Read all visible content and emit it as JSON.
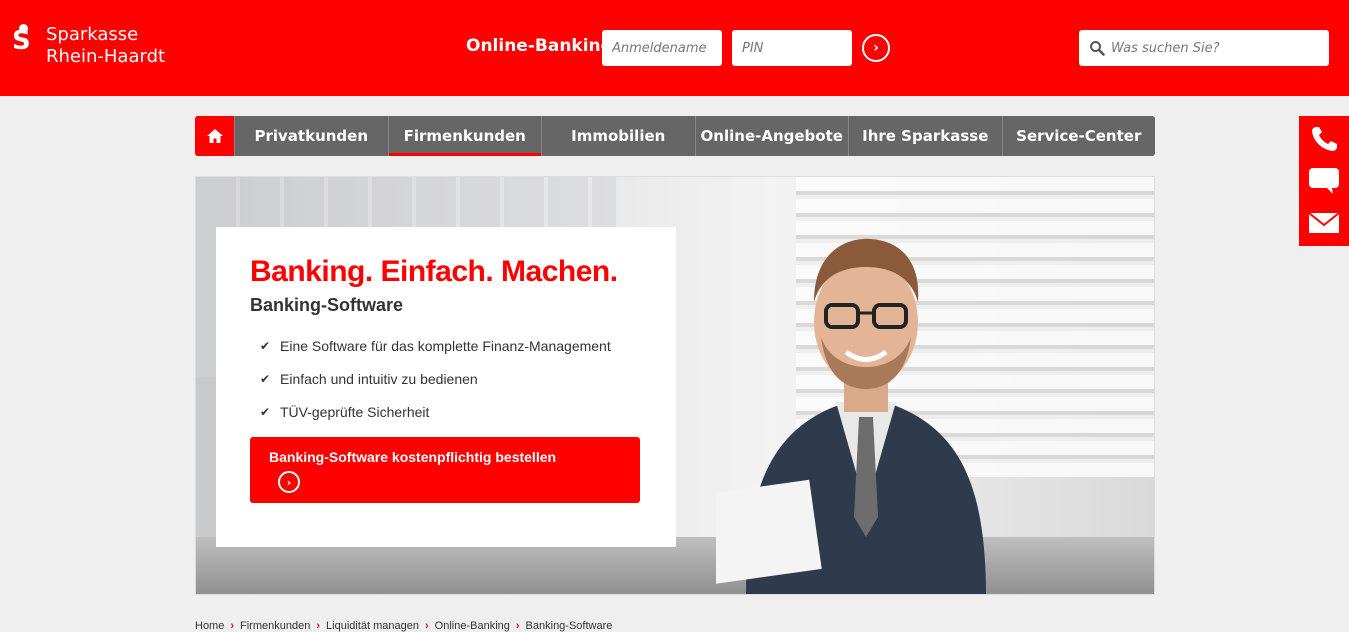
{
  "brand": {
    "line1": "Sparkasse",
    "line2": "Rhein-Haardt",
    "logo_letter": "S",
    "color": "#ff0000"
  },
  "login": {
    "label": "Online-Banking",
    "username_placeholder": "Anmeldename",
    "pin_placeholder": "PIN",
    "submit_icon": "chevron-right-circle-icon"
  },
  "search": {
    "placeholder": "Was suchen Sie?",
    "icon": "search-icon"
  },
  "nav": {
    "home_icon": "home-icon",
    "items": [
      {
        "label": "Privatkunden",
        "active": false
      },
      {
        "label": "Firmenkunden",
        "active": true
      },
      {
        "label": "Immobilien",
        "active": false
      },
      {
        "label": "Online-Angebote",
        "active": false
      },
      {
        "label": "Ihre Sparkasse",
        "active": false
      },
      {
        "label": "Service-Center",
        "active": false
      }
    ]
  },
  "side_contact": {
    "icons": [
      "phone-icon",
      "chat-icon",
      "mail-icon"
    ]
  },
  "hero": {
    "headline": "Banking. Einfach. Machen.",
    "subhead": "Banking-Software",
    "bullets": [
      "Eine Software für das komplette Finanz-Management",
      "Einfach und intuitiv zu bedienen",
      "TÜV-geprüfte Sicherheit"
    ],
    "cta_label": "Banking-Software kostenpflichtig bestellen"
  },
  "breadcrumb": [
    "Home",
    "Firmenkunden",
    "Liquidität managen",
    "Online-Banking",
    "Banking-Software"
  ]
}
